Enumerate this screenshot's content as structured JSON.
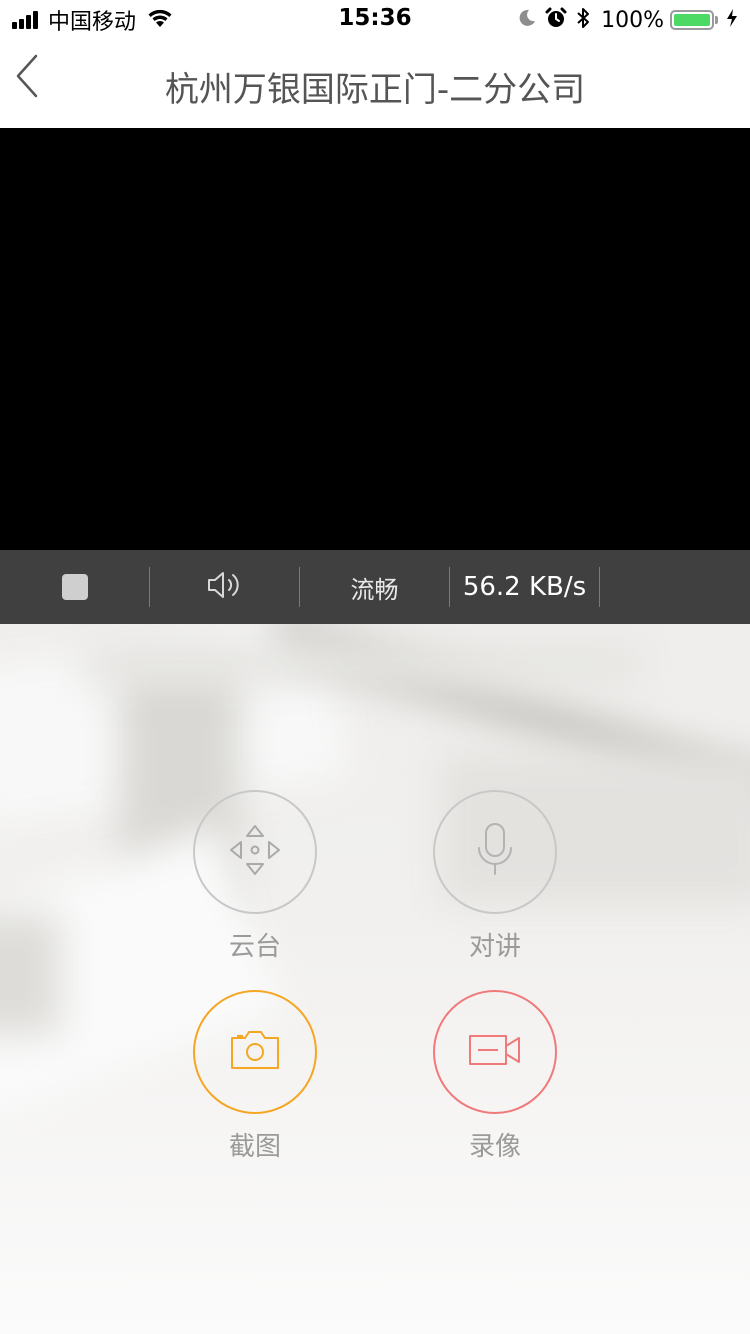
{
  "status_bar": {
    "carrier": "中国移动",
    "time": "15:36",
    "battery_percent": "100%",
    "battery_level": 1.0,
    "icons": [
      "signal-icon",
      "wifi-icon",
      "moon-icon",
      "alarm-icon",
      "bluetooth-icon",
      "battery-icon",
      "charging-icon"
    ]
  },
  "nav": {
    "title": "杭州万银国际正门-二分公司",
    "back_icon": "back-chevron-icon"
  },
  "player": {
    "controls": {
      "stop_icon": "stop-icon",
      "volume_icon": "volume-icon",
      "quality": "流畅",
      "rate": "56.2 KB/s"
    }
  },
  "actions": [
    {
      "label": "云台",
      "icon": "ptz-direction-icon",
      "color": "#bdbdbd"
    },
    {
      "label": "对讲",
      "icon": "microphone-icon",
      "color": "#bdbdbd"
    },
    {
      "label": "截图",
      "icon": "camera-icon",
      "color": "#f5a623"
    },
    {
      "label": "录像",
      "icon": "video-record-icon",
      "color": "#f07a7a"
    }
  ],
  "colors": {
    "accent_orange": "#f5a623",
    "accent_red": "#f07a7a",
    "control_bar": "#404040",
    "video_bg": "#000000"
  }
}
